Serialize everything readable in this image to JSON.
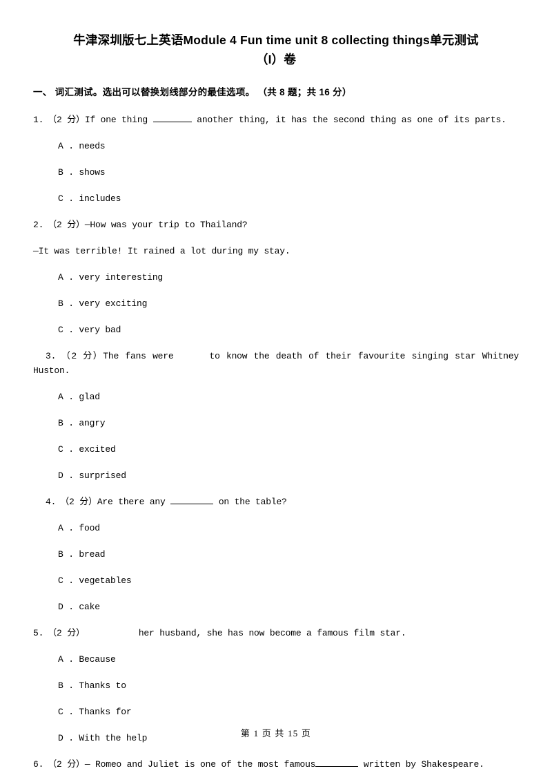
{
  "document": {
    "title_line1": "牛津深圳版七上英语Module 4 Fun time unit 8 collecting things单元测试",
    "title_line2": "（I）卷",
    "section_heading": "一、 词汇测试。选出可以替换划线部分的最佳选项。 （共 8 题；共 16 分）",
    "footer": "第 1 页 共 15 页"
  },
  "questions": [
    {
      "number": "1.",
      "score": "（2 分）",
      "stem_before": "If one thing ",
      "stem_after": " another thing, it has the second thing as one of its parts.",
      "options": [
        "A . needs",
        "B . shows",
        "C . includes"
      ]
    },
    {
      "number": "2.",
      "score": "（2 分）",
      "stem_before": "—How was your trip to Thailand?",
      "stem_after": "",
      "continuation": "—It was terrible! It rained a lot during my stay.",
      "options": [
        "A . very interesting",
        "B . very exciting",
        "C . very bad"
      ]
    },
    {
      "number": "3.",
      "score": "（2 分）",
      "stem_before": "The fans were",
      "stem_after": "to know the death of their favourite singing star Whitney",
      "continuation": "Huston.",
      "options": [
        "A . glad",
        "B . angry",
        "C . excited",
        "D . surprised"
      ]
    },
    {
      "number": "4.",
      "score": "（2 分）",
      "stem_before": "Are there any ",
      "stem_after": " on the table?",
      "options": [
        "A . food",
        "B . bread",
        "C . vegetables",
        "D . cake"
      ]
    },
    {
      "number": "5.",
      "score": "（2 分）",
      "stem_before": "",
      "stem_after": "her husband, she has now become a famous film star.",
      "options": [
        "A . Because",
        "B . Thanks to",
        "C . Thanks for",
        "D . With the help"
      ]
    },
    {
      "number": "6.",
      "score": "（2 分）",
      "stem_before": "— Romeo and Juliet is one of the most famous",
      "stem_after": " written by Shakespeare.",
      "options": []
    }
  ]
}
